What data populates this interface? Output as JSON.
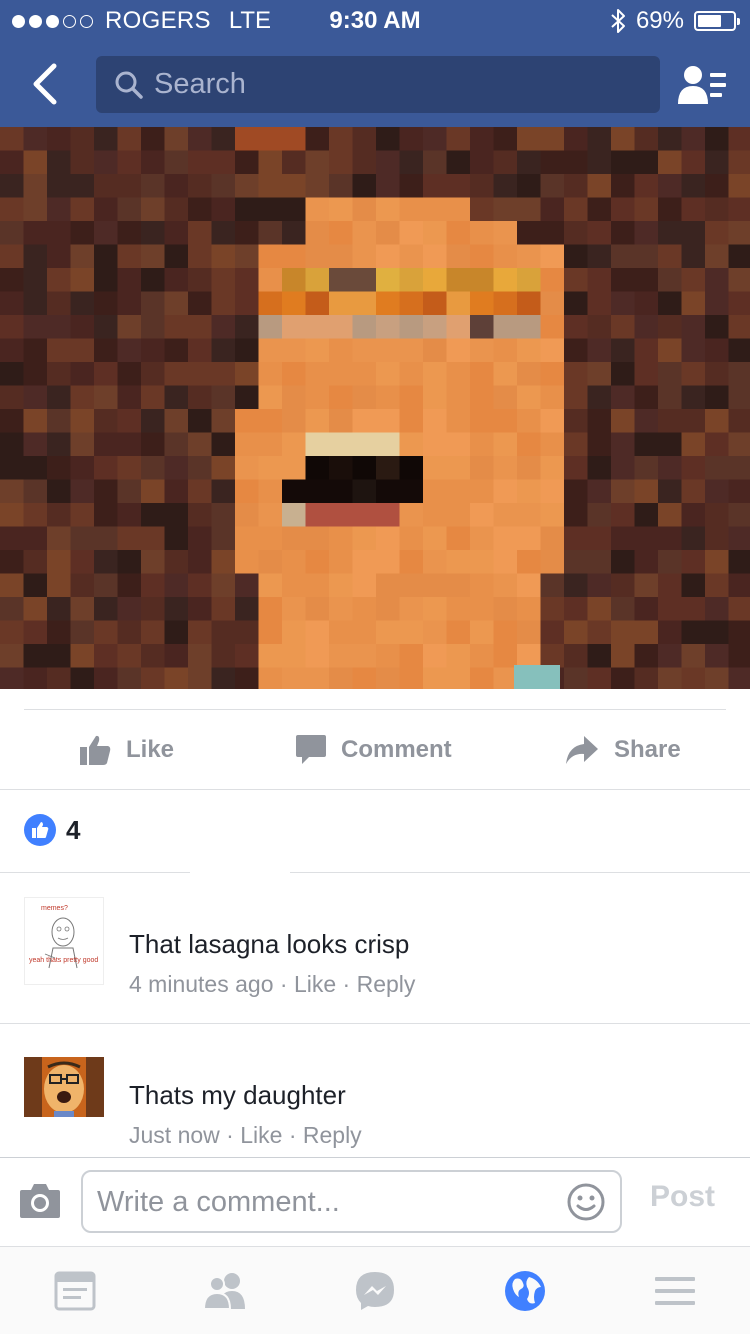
{
  "status_bar": {
    "carrier": "ROGERS",
    "network": "LTE",
    "time": "9:30 AM",
    "battery_text": "69%",
    "battery_level": 0.69,
    "signal_bars_filled": 3,
    "signal_bars_total": 5
  },
  "header": {
    "search_placeholder": "Search"
  },
  "post": {
    "actions": {
      "like": "Like",
      "comment": "Comment",
      "share": "Share"
    },
    "like_count": "4"
  },
  "comments": [
    {
      "avatar_text_top": "memes?",
      "avatar_text_bottom": "yeah thats pretty good",
      "text": "That lasagna looks crisp",
      "time": "4 minutes ago",
      "like": "Like",
      "reply": "Reply",
      "sep": "·"
    },
    {
      "text": "Thats my daughter",
      "time": "Just now",
      "like": "Like",
      "reply": "Reply",
      "sep": "·"
    }
  ],
  "composer": {
    "placeholder": "Write a comment...",
    "post_label": "Post"
  },
  "colors": {
    "brand": "#3b5998",
    "search_bg": "#2d4373",
    "like_blue": "#4080ff",
    "meta_gray": "#90949c",
    "active_tab": "#4080ff"
  },
  "tabs": [
    {
      "icon": "news-feed-icon",
      "active": false
    },
    {
      "icon": "friends-icon",
      "active": false
    },
    {
      "icon": "messenger-icon",
      "active": false
    },
    {
      "icon": "globe-notifications-icon",
      "active": true
    },
    {
      "icon": "menu-icon",
      "active": false
    }
  ]
}
